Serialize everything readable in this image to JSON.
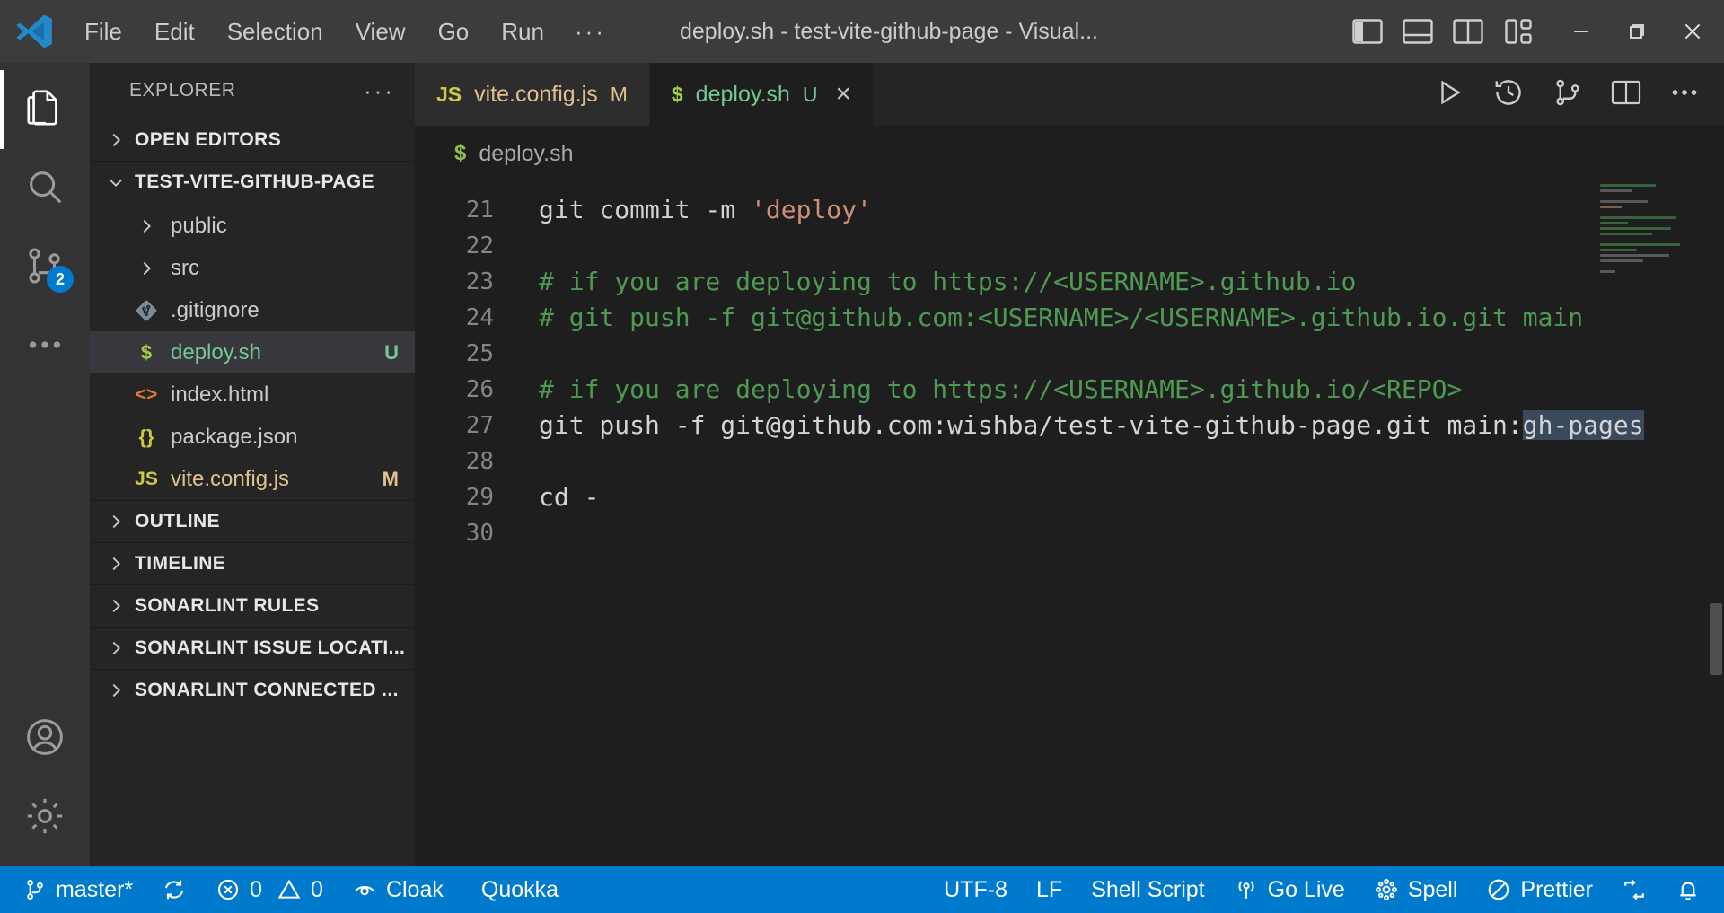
{
  "titlebar": {
    "logo_icon": "vscode-logo-icon",
    "menus": [
      {
        "label": "File",
        "name": "menu-file"
      },
      {
        "label": "Edit",
        "name": "menu-edit"
      },
      {
        "label": "Selection",
        "name": "menu-selection"
      },
      {
        "label": "View",
        "name": "menu-view"
      },
      {
        "label": "Go",
        "name": "menu-go"
      },
      {
        "label": "Run",
        "name": "menu-run"
      },
      {
        "label": "···",
        "name": "menu-more"
      }
    ],
    "window_title": "deploy.sh - test-vite-github-page - Visual...",
    "layout_icons": [
      {
        "name": "toggle-primary-sidebar-icon"
      },
      {
        "name": "toggle-panel-icon"
      },
      {
        "name": "toggle-secondary-sidebar-icon"
      },
      {
        "name": "customize-layout-icon"
      }
    ],
    "window_controls": [
      {
        "name": "minimize-button",
        "glyph": "minimize"
      },
      {
        "name": "maximize-restore-button",
        "glyph": "restore"
      },
      {
        "name": "close-button",
        "glyph": "close"
      }
    ]
  },
  "activitybar": {
    "items": [
      {
        "name": "activity-explorer",
        "icon": "files-icon",
        "active": true,
        "badge": ""
      },
      {
        "name": "activity-search",
        "icon": "search-icon",
        "active": false,
        "badge": ""
      },
      {
        "name": "activity-source-control",
        "icon": "source-control-icon",
        "active": false,
        "badge": "2"
      },
      {
        "name": "activity-more",
        "icon": "ellipsis-icon",
        "active": false,
        "badge": ""
      }
    ],
    "bottom_items": [
      {
        "name": "activity-accounts",
        "icon": "account-icon"
      },
      {
        "name": "activity-settings",
        "icon": "gear-icon"
      }
    ]
  },
  "sidebar": {
    "title": "EXPLORER",
    "more_actions": "···",
    "sections": {
      "open_editors": "OPEN EDITORS",
      "workspace": "TEST-VITE-GITHUB-PAGE",
      "outline": "OUTLINE",
      "timeline": "TIMELINE",
      "sonarlint_rules": "SONARLINT RULES",
      "sonarlint_issues": "SONARLINT ISSUE LOCATI...",
      "sonarlint_connected": "SONARLINT CONNECTED ..."
    },
    "files": [
      {
        "name": "tree-item-public",
        "label": "public",
        "kind": "folder",
        "icon": "chevron-right-icon",
        "icon_glyph": "",
        "icon_color": "#cccccc",
        "text_color": "#cccccc",
        "status": "",
        "status_color": "",
        "selected": false
      },
      {
        "name": "tree-item-src",
        "label": "src",
        "kind": "folder",
        "icon": "chevron-right-icon",
        "icon_glyph": "",
        "icon_color": "#cccccc",
        "text_color": "#cccccc",
        "status": "",
        "status_color": "",
        "selected": false
      },
      {
        "name": "tree-item-gitignore",
        "label": ".gitignore",
        "kind": "file",
        "icon": "git-file-icon",
        "icon_glyph": "◆",
        "icon_color": "#8b9ba8",
        "text_color": "#cccccc",
        "status": "",
        "status_color": "",
        "selected": false
      },
      {
        "name": "tree-item-deploy-sh",
        "label": "deploy.sh",
        "kind": "file",
        "icon": "shell-file-icon",
        "icon_glyph": "$",
        "icon_color": "#a4cc4b",
        "text_color": "#73c991",
        "status": "U",
        "status_color": "#73c991",
        "selected": true
      },
      {
        "name": "tree-item-index-html",
        "label": "index.html",
        "kind": "file",
        "icon": "html-file-icon",
        "icon_glyph": "<>",
        "icon_color": "#e37933",
        "text_color": "#cccccc",
        "status": "",
        "status_color": "",
        "selected": false
      },
      {
        "name": "tree-item-package-json",
        "label": "package.json",
        "kind": "file",
        "icon": "json-file-icon",
        "icon_glyph": "{}",
        "icon_color": "#cbcb41",
        "text_color": "#cccccc",
        "status": "",
        "status_color": "",
        "selected": false
      },
      {
        "name": "tree-item-vite-config",
        "label": "vite.config.js",
        "kind": "file",
        "icon": "js-file-icon",
        "icon_glyph": "JS",
        "icon_color": "#cbcb41",
        "text_color": "#e2c08d",
        "status": "M",
        "status_color": "#e2c08d",
        "selected": false
      }
    ]
  },
  "editor": {
    "tabs": [
      {
        "name": "tab-vite-config-js",
        "label": "vite.config.js",
        "icon_glyph": "JS",
        "icon_color": "#cbcb41",
        "badge": "M",
        "badge_color": "#e2c08d",
        "text_color": "#e2c08d",
        "active": false,
        "closable": false
      },
      {
        "name": "tab-deploy-sh",
        "label": "deploy.sh",
        "icon_glyph": "$",
        "icon_color": "#a4cc4b",
        "badge": "U",
        "badge_color": "#73c991",
        "text_color": "#73c991",
        "active": true,
        "closable": true
      }
    ],
    "tab_close_glyph": "×",
    "tab_actions": [
      {
        "name": "run-code-button",
        "icon": "play-icon"
      },
      {
        "name": "timeline-history-button",
        "icon": "history-icon"
      },
      {
        "name": "source-control-graph-button",
        "icon": "git-graph-icon"
      },
      {
        "name": "split-editor-right-button",
        "icon": "split-editor-icon"
      },
      {
        "name": "editor-more-actions-button",
        "icon": "ellipsis-icon"
      }
    ],
    "breadcrumb": {
      "icon_glyph": "$",
      "label": "deploy.sh"
    },
    "lines": [
      {
        "num": "21",
        "segments": [
          {
            "text": "git commit -m ",
            "cls": "plain"
          },
          {
            "text": "'deploy'",
            "cls": "string"
          }
        ]
      },
      {
        "num": "22",
        "segments": []
      },
      {
        "num": "23",
        "segments": [
          {
            "text": "# if you are deploying to https://<USERNAME>.github.io",
            "cls": "comment"
          }
        ]
      },
      {
        "num": "24",
        "segments": [
          {
            "text": "# git push -f git@github.com:<USERNAME>/<USERNAME>.github.io.git main",
            "cls": "comment"
          }
        ]
      },
      {
        "num": "25",
        "segments": []
      },
      {
        "num": "26",
        "segments": [
          {
            "text": "# if you are deploying to https://<USERNAME>.github.io/<REPO>",
            "cls": "comment"
          }
        ]
      },
      {
        "num": "27",
        "segments": [
          {
            "text": "git push -f git@github.com:wishba/test-vite-github-page.git main:",
            "cls": "plain"
          },
          {
            "text": "gh-pages",
            "cls": "selected"
          }
        ]
      },
      {
        "num": "28",
        "segments": []
      },
      {
        "num": "29",
        "segments": [
          {
            "text": "cd -",
            "cls": "plain"
          }
        ]
      },
      {
        "num": "30",
        "segments": []
      }
    ]
  },
  "statusbar": {
    "left_items": [
      {
        "name": "status-branch",
        "icon": "source-control-branch-icon",
        "label": "master*"
      },
      {
        "name": "status-sync",
        "icon": "sync-icon",
        "label": ""
      },
      {
        "name": "status-problems",
        "icon": "error-warning-icon",
        "label": "0  0",
        "errors": "0",
        "warnings": "0"
      },
      {
        "name": "status-cloak",
        "icon": "cloak-icon",
        "label": "Cloak"
      },
      {
        "name": "status-quokka",
        "icon": "",
        "label": "Quokka"
      }
    ],
    "right_items": [
      {
        "name": "status-encoding",
        "icon": "",
        "label": "UTF-8"
      },
      {
        "name": "status-eol",
        "icon": "",
        "label": "LF"
      },
      {
        "name": "status-language",
        "icon": "",
        "label": "Shell Script"
      },
      {
        "name": "status-golive",
        "icon": "broadcast-icon",
        "label": "Go Live"
      },
      {
        "name": "status-spell",
        "icon": "spell-icon",
        "label": "Spell"
      },
      {
        "name": "status-prettier",
        "icon": "prettier-icon",
        "label": "Prettier"
      },
      {
        "name": "status-remote",
        "icon": "remote-icon",
        "label": ""
      },
      {
        "name": "status-notifications",
        "icon": "bell-icon",
        "label": ""
      }
    ]
  },
  "colors": {
    "accent": "#007acc",
    "titlebar_bg": "#3c3c3c",
    "sidebar_bg": "#252526",
    "editor_bg": "#1e1e1e",
    "activitybar_bg": "#333333",
    "selection": "#3a4a5c",
    "comment": "#4e9a53",
    "string": "#ce9178"
  }
}
